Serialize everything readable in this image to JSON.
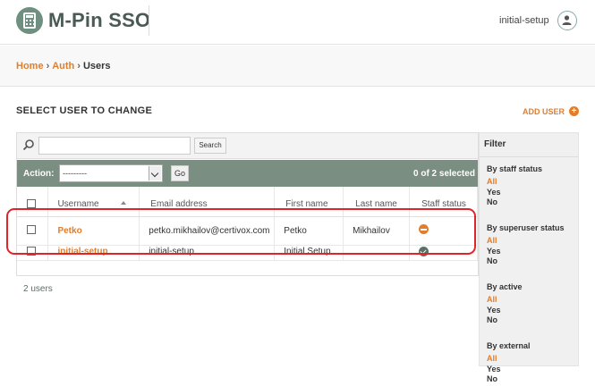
{
  "header": {
    "brand": "M-Pin SSO",
    "user_name": "initial-setup"
  },
  "breadcrumbs": {
    "home": "Home",
    "auth": "Auth",
    "current": "Users",
    "separator": "›"
  },
  "page": {
    "title": "SELECT USER TO CHANGE",
    "add_user": "ADD USER"
  },
  "search": {
    "value": "",
    "button": "Search"
  },
  "actions": {
    "label": "Action:",
    "selected_option": "---------",
    "go": "Go",
    "count": "0 of 2 selected"
  },
  "table": {
    "headers": [
      "Username",
      "Email address",
      "First name",
      "Last name",
      "Staff status"
    ],
    "rows": [
      {
        "username": "Petko",
        "email": "petko.mikhailov@certivox.com",
        "first_name": "Petko",
        "last_name": "Mikhailov",
        "staff_status": "no"
      },
      {
        "username": "initial-setup",
        "email": "initial-setup",
        "first_name": "Initial Setup",
        "last_name": "",
        "staff_status": "yes"
      }
    ]
  },
  "paginator": "2 users",
  "filter": {
    "title": "Filter",
    "groups": [
      {
        "title": "By staff status",
        "options": [
          "All",
          "Yes",
          "No"
        ]
      },
      {
        "title": "By superuser status",
        "options": [
          "All",
          "Yes",
          "No"
        ]
      },
      {
        "title": "By active",
        "options": [
          "All",
          "Yes",
          "No"
        ]
      },
      {
        "title": "By external",
        "options": [
          "All",
          "Yes",
          "No"
        ]
      }
    ]
  },
  "colors": {
    "accent": "#e37d2a",
    "action_bar": "#7a8f82",
    "highlight": "#e0242a"
  }
}
